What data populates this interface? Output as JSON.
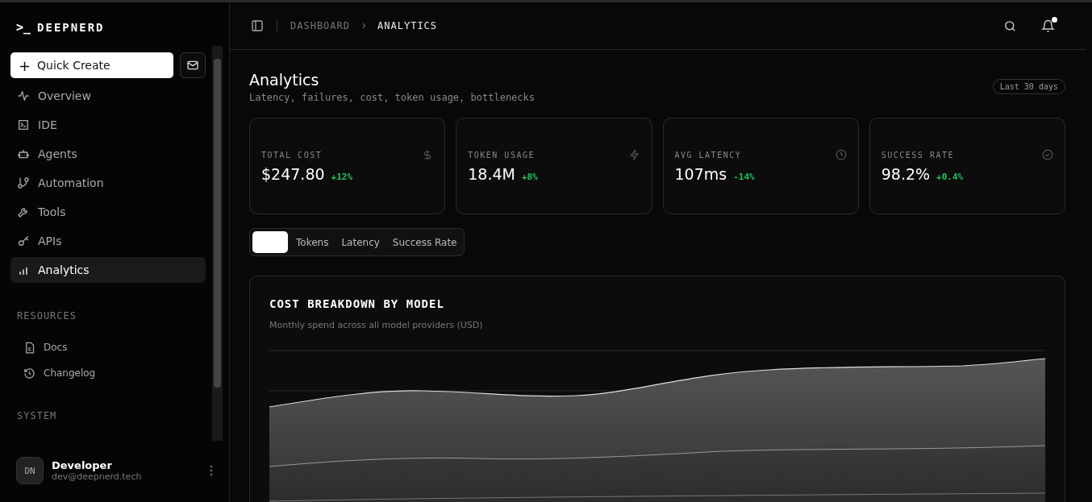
{
  "brand": {
    "prompt": ">_",
    "name": "DEEPNERD"
  },
  "quick_create": {
    "icon": "+",
    "label": "Quick Create"
  },
  "nav": [
    {
      "label": "Overview",
      "selected": false
    },
    {
      "label": "IDE",
      "selected": false
    },
    {
      "label": "Agents",
      "selected": false
    },
    {
      "label": "Automation",
      "selected": false
    },
    {
      "label": "Tools",
      "selected": false
    },
    {
      "label": "APIs",
      "selected": false
    },
    {
      "label": "Analytics",
      "selected": true
    }
  ],
  "resources": {
    "title": "RESOURCES",
    "items": [
      {
        "label": "Docs"
      },
      {
        "label": "Changelog"
      }
    ]
  },
  "system": {
    "title": "SYSTEM"
  },
  "user": {
    "initials": "DN",
    "name": "Developer",
    "email": "dev@deepnerd.tech"
  },
  "breadcrumb": [
    "DASHBOARD",
    "ANALYTICS"
  ],
  "notifications": {
    "unread": true
  },
  "page": {
    "title": "Analytics",
    "subtitle": "Latency, failures, cost, token usage, bottlenecks",
    "range": "Last 30 days"
  },
  "stats": [
    {
      "label": "TOTAL COST",
      "value": "$247.80",
      "change": "+12%",
      "color": "#22c55e"
    },
    {
      "label": "TOKEN USAGE",
      "value": "18.4M",
      "change": "+8%",
      "color": "#22c55e"
    },
    {
      "label": "AVG LATENCY",
      "value": "107ms",
      "change": "-14%",
      "color": "#22c55e"
    },
    {
      "label": "SUCCESS RATE",
      "value": "98.2%",
      "change": "+0.4%",
      "color": "#22c55e"
    }
  ],
  "tabs": [
    {
      "selected": true
    },
    {
      "label": "Tokens",
      "selected": false
    },
    {
      "label": "Latency",
      "selected": false
    },
    {
      "label": "Success Rate",
      "selected": false
    }
  ],
  "chart": {
    "title": "COST BREAKDOWN BY MODEL",
    "subtitle": "Monthly spend across all model providers (USD)"
  }
}
